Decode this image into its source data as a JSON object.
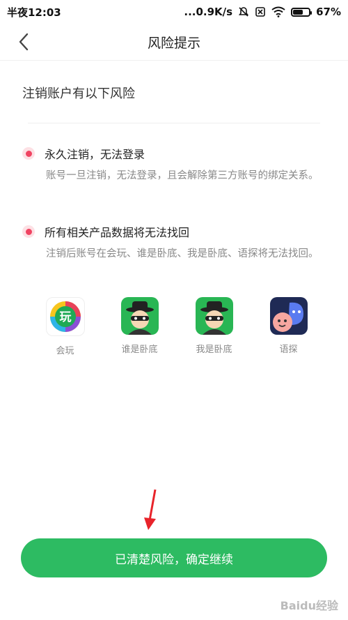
{
  "status_bar": {
    "time": "半夜12:03",
    "network_speed": "...0.9K/s",
    "battery_percent": "67%",
    "battery_level": 0.67
  },
  "nav": {
    "title": "风险提示",
    "back_icon": "chevron-left-icon"
  },
  "heading": "注销账户有以下风险",
  "risks": [
    {
      "title": "永久注销，无法登录",
      "desc": "账号一旦注销，无法登录，且会解除第三方账号的绑定关系。"
    },
    {
      "title": "所有相关产品数据将无法找回",
      "desc": "注销后账号在会玩、谁是卧底、我是卧底、语探将无法找回。"
    }
  ],
  "apps": [
    {
      "label": "会玩"
    },
    {
      "label": "谁是卧底"
    },
    {
      "label": "我是卧底"
    },
    {
      "label": "语探"
    }
  ],
  "cta": {
    "label": "已清楚风险，确定继续"
  },
  "watermark": "Baidu经验",
  "colors": {
    "accent": "#2dbb62",
    "dot": "#f04462",
    "arrow": "#e8232a"
  }
}
